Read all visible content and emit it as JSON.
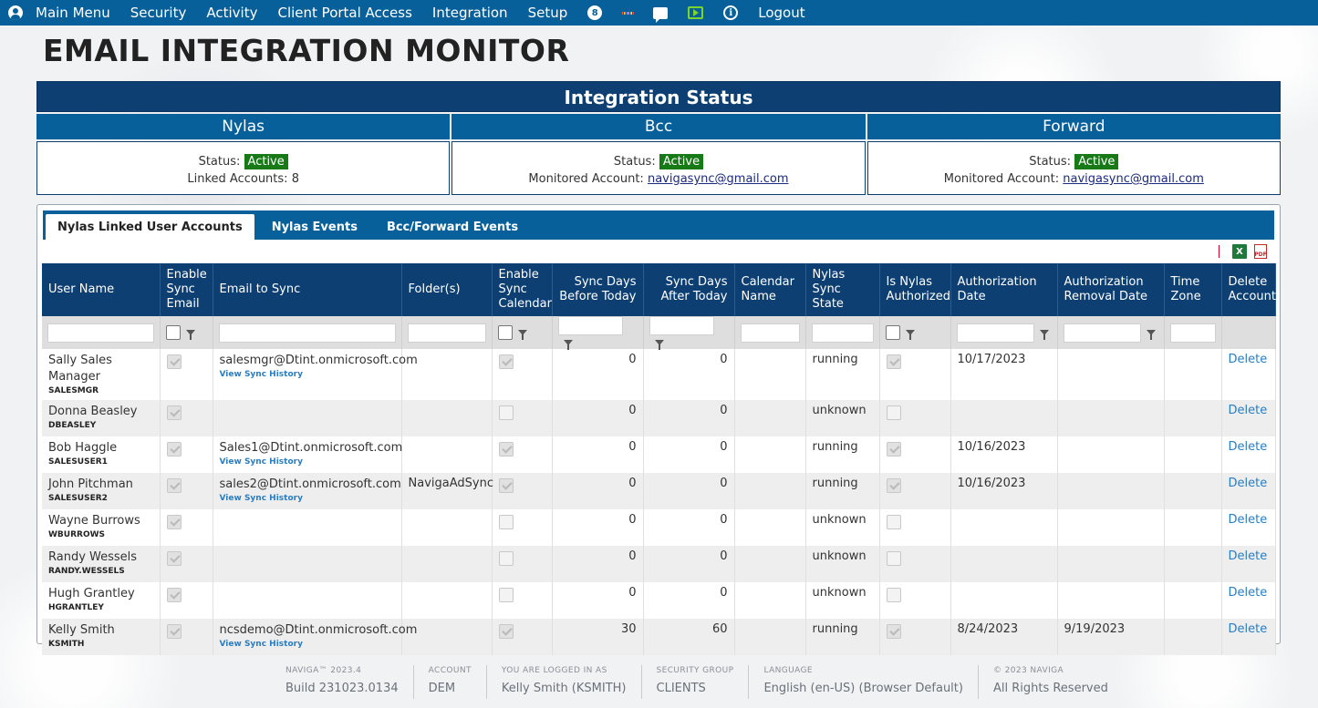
{
  "nav": {
    "items": [
      "Main Menu",
      "Security",
      "Activity",
      "Client Portal Access",
      "Integration",
      "Setup"
    ],
    "badge_count": "8",
    "logout": "Logout",
    "icons": [
      "user-icon",
      "notification-badge",
      "apps-grid-icon",
      "chat-icon",
      "tv-icon",
      "info-icon"
    ]
  },
  "page_title": "EMAIL INTEGRATION MONITOR",
  "integration_status": {
    "title": "Integration Status",
    "status_label": "Status:",
    "cols": [
      {
        "name": "Nylas",
        "status": "Active",
        "detail_label": "Linked Accounts:",
        "detail_value": "8"
      },
      {
        "name": "Bcc",
        "status": "Active",
        "detail_label": "Monitored Account:",
        "detail_value": "navigasync@gmail.com"
      },
      {
        "name": "Forward",
        "status": "Active",
        "detail_label": "Monitored Account:",
        "detail_value": "navigasync@gmail.com"
      }
    ],
    "colors": {
      "active": "#177a17",
      "header": "#0d3f72",
      "subheader": "#07609a"
    }
  },
  "tabs": [
    "Nylas Linked User Accounts",
    "Nylas Events",
    "Bcc/Forward Events"
  ],
  "export_icons": [
    "excel-export-icon",
    "pdf-export-icon"
  ],
  "table": {
    "headers": [
      "User Name",
      "Enable Sync Email",
      "Email to Sync",
      "Folder(s)",
      "Enable Sync Calendar",
      "Sync Days Before Today",
      "Sync Days After Today",
      "Calendar Name",
      "Nylas Sync State",
      "Is Nylas Authorized",
      "Authorization Date",
      "Authorization Removal Date",
      "Time Zone",
      "Delete Account"
    ],
    "view_history_label": "View Sync History",
    "delete_label": "Delete",
    "rows": [
      {
        "name": "Sally Sales Manager",
        "code": "SALESMGR",
        "sync_email": true,
        "email": "salesmgr@Dtint.onmicrosoft.com",
        "folders": "",
        "sync_cal": true,
        "before": "0",
        "after": "0",
        "cal_name": "",
        "state": "running",
        "authorized": true,
        "auth_date": "10/17/2023",
        "removal_date": "",
        "tz": ""
      },
      {
        "name": "Donna Beasley",
        "code": "DBEASLEY",
        "sync_email": true,
        "email": "",
        "folders": "",
        "sync_cal": false,
        "before": "0",
        "after": "0",
        "cal_name": "",
        "state": "unknown",
        "authorized": false,
        "auth_date": "",
        "removal_date": "",
        "tz": ""
      },
      {
        "name": "Bob Haggle",
        "code": "SALESUSER1",
        "sync_email": true,
        "email": "Sales1@Dtint.onmicrosoft.com",
        "folders": "",
        "sync_cal": true,
        "before": "0",
        "after": "0",
        "cal_name": "",
        "state": "running",
        "authorized": true,
        "auth_date": "10/16/2023",
        "removal_date": "",
        "tz": ""
      },
      {
        "name": "John Pitchman",
        "code": "SALESUSER2",
        "sync_email": true,
        "email": "sales2@Dtint.onmicrosoft.com",
        "folders": "NavigaAdSync",
        "sync_cal": true,
        "before": "0",
        "after": "0",
        "cal_name": "",
        "state": "running",
        "authorized": true,
        "auth_date": "10/16/2023",
        "removal_date": "",
        "tz": ""
      },
      {
        "name": "Wayne Burrows",
        "code": "WBURROWS",
        "sync_email": true,
        "email": "",
        "folders": "",
        "sync_cal": false,
        "before": "0",
        "after": "0",
        "cal_name": "",
        "state": "unknown",
        "authorized": false,
        "auth_date": "",
        "removal_date": "",
        "tz": ""
      },
      {
        "name": "Randy Wessels",
        "code": "RANDY.WESSELS",
        "sync_email": true,
        "email": "",
        "folders": "",
        "sync_cal": false,
        "before": "0",
        "after": "0",
        "cal_name": "",
        "state": "unknown",
        "authorized": false,
        "auth_date": "",
        "removal_date": "",
        "tz": ""
      },
      {
        "name": "Hugh Grantley",
        "code": "HGRANTLEY",
        "sync_email": true,
        "email": "",
        "folders": "",
        "sync_cal": false,
        "before": "0",
        "after": "0",
        "cal_name": "",
        "state": "unknown",
        "authorized": false,
        "auth_date": "",
        "removal_date": "",
        "tz": ""
      },
      {
        "name": "Kelly Smith",
        "code": "KSMITH",
        "sync_email": true,
        "email": "ncsdemo@Dtint.onmicrosoft.com",
        "folders": "",
        "sync_cal": true,
        "before": "30",
        "after": "60",
        "cal_name": "",
        "state": "running",
        "authorized": true,
        "auth_date": "8/24/2023",
        "removal_date": "9/19/2023",
        "tz": ""
      }
    ]
  },
  "footer": [
    {
      "label": "NAVIGA™ 2023.4",
      "value": "Build 231023.0134"
    },
    {
      "label": "ACCOUNT",
      "value": "DEM"
    },
    {
      "label": "YOU ARE LOGGED IN AS",
      "value": "Kelly Smith (KSMITH)"
    },
    {
      "label": "SECURITY GROUP",
      "value": "CLIENTS"
    },
    {
      "label": "LANGUAGE",
      "value": "English (en-US) (Browser Default)"
    },
    {
      "label": "© 2023 NAVIGA",
      "value": "All Rights Reserved"
    }
  ]
}
